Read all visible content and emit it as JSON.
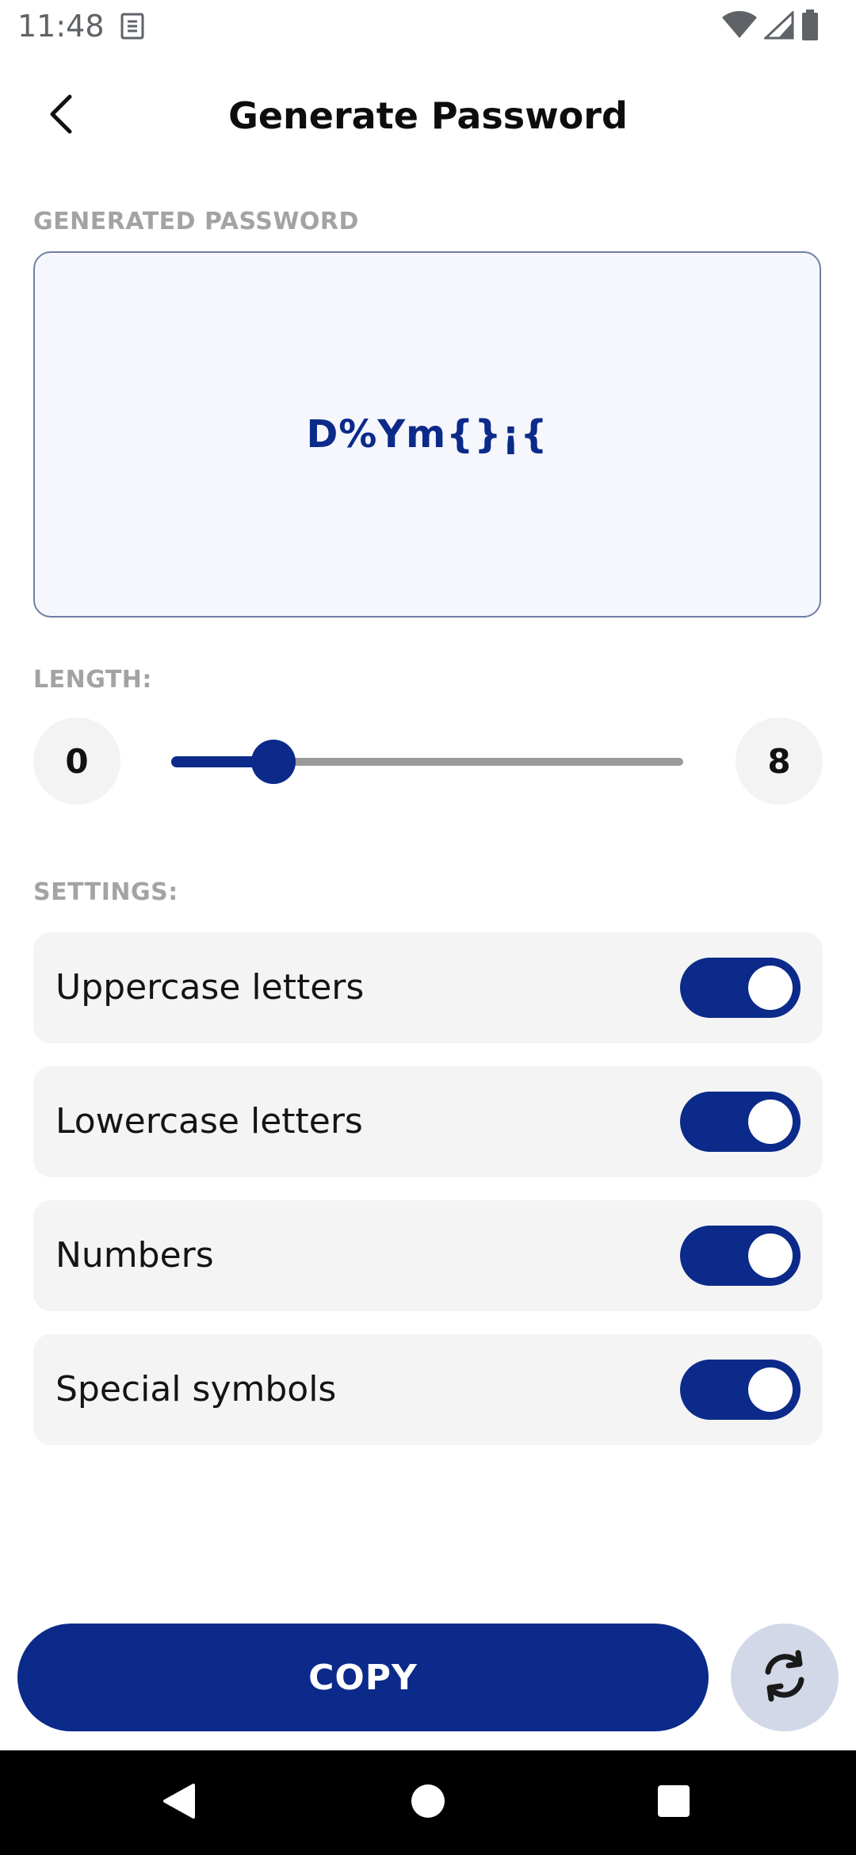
{
  "status_bar": {
    "time": "11:48"
  },
  "header": {
    "title": "Generate Password"
  },
  "password_section": {
    "label": "GENERATED PASSWORD",
    "value": "D%Ym{}¡{"
  },
  "length_section": {
    "label": "LENGTH:",
    "min_value": "0",
    "current_value": "8",
    "slider_fraction": 0.2
  },
  "settings_section": {
    "label": "SETTINGS:",
    "items": [
      {
        "label": "Uppercase letters",
        "enabled": true
      },
      {
        "label": "Lowercase letters",
        "enabled": true
      },
      {
        "label": "Numbers",
        "enabled": true
      },
      {
        "label": "Special symbols",
        "enabled": true
      }
    ]
  },
  "actions": {
    "copy_label": "COPY"
  },
  "colors": {
    "primary": "#0b2a8a",
    "card_background": "#f4f4f4",
    "label_gray": "#a3a3a3"
  },
  "icons": {
    "back": "arrow-back-icon",
    "refresh": "refresh-icon"
  }
}
